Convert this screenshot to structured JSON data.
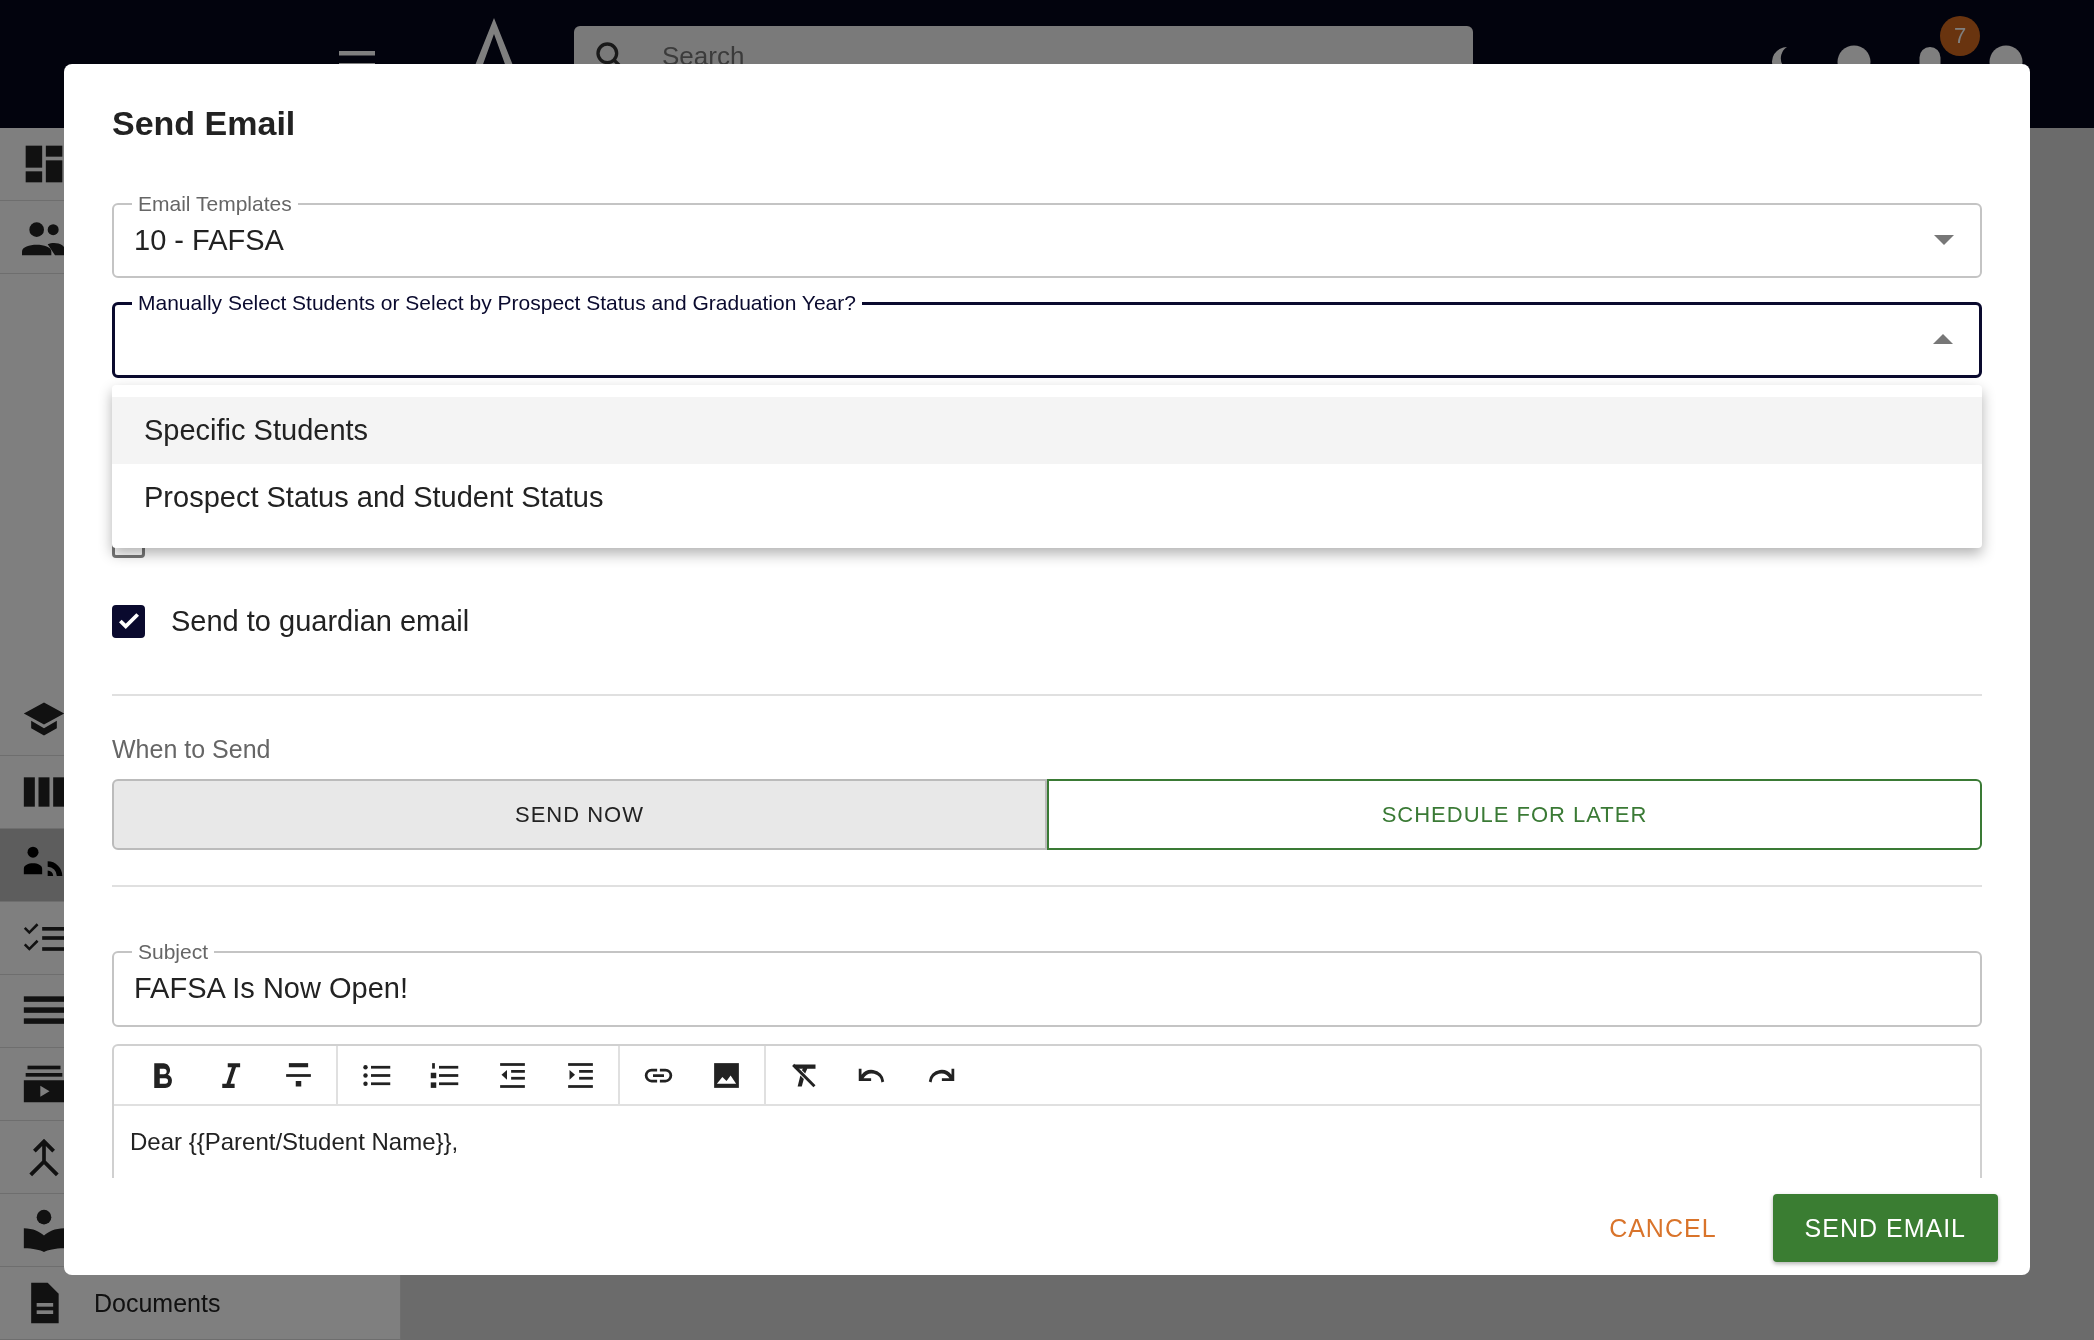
{
  "topbar": {
    "search": {
      "placeholder": "Search"
    },
    "notification_count": "7"
  },
  "sidebar": {
    "items": [
      {
        "selected": false
      },
      {
        "selected": false
      },
      {
        "selected": false
      },
      {
        "selected": false
      },
      {
        "selected": true
      },
      {
        "selected": false
      },
      {
        "selected": false
      },
      {
        "selected": false
      },
      {
        "selected": false
      },
      {
        "selected": false
      },
      {
        "label": "Documents",
        "selected": false
      }
    ]
  },
  "dialog": {
    "title": "Send Email",
    "template_field": {
      "label": "Email Templates",
      "value": "10 - FAFSA"
    },
    "selection_field": {
      "label": "Manually Select Students or Select by Prospect Status and Graduation Year?",
      "expanded": true
    },
    "menu": [
      {
        "label": "Specific Students",
        "selected": true
      },
      {
        "label": "Prospect Status and Student Status",
        "selected": false
      }
    ],
    "recipients": [
      {
        "checked": false
      },
      {
        "label": "Send to guardian email",
        "checked": true
      }
    ],
    "when_to_send": {
      "label": "When to Send",
      "options": [
        {
          "label": "SEND NOW",
          "selected": true
        },
        {
          "label": "SCHEDULE FOR LATER",
          "selected": false
        }
      ]
    },
    "subject_field": {
      "label": "Subject",
      "value": "FAFSA Is Now Open!"
    },
    "editor": {
      "body": "Dear {{Parent/Student Name}},"
    },
    "actions": [
      {
        "label": "CANCEL",
        "kind": "text"
      },
      {
        "label": "SEND EMAIL",
        "kind": "contained"
      }
    ]
  }
}
